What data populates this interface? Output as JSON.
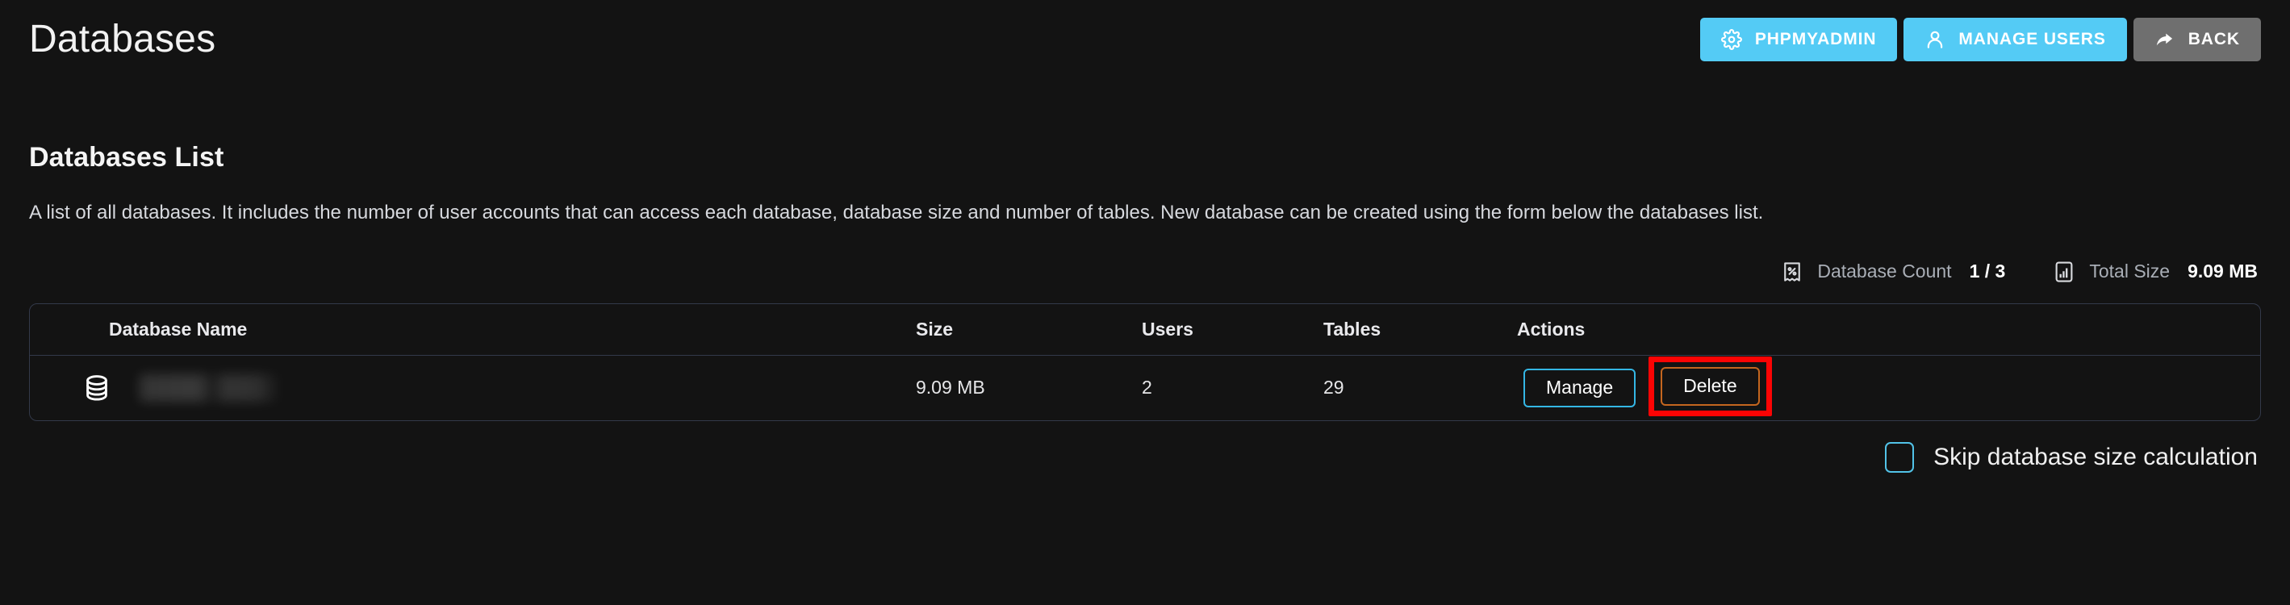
{
  "header": {
    "title": "Databases",
    "buttons": [
      {
        "label": "PHPMYADMIN",
        "icon": "gear-icon",
        "style": "primary"
      },
      {
        "label": "MANAGE USERS",
        "icon": "user-icon",
        "style": "primary"
      },
      {
        "label": "BACK",
        "icon": "arrow-share-icon",
        "style": "secondary"
      }
    ]
  },
  "main": {
    "section_title": "Databases List",
    "description": "A list of all databases. It includes the number of user accounts that can access each database, database size and number of tables. New database can be created using the form below the databases list.",
    "stats": [
      {
        "icon": "receipt-percent-icon",
        "label": "Database Count",
        "value": "1 / 3"
      },
      {
        "icon": "bar-chart-icon",
        "label": "Total Size",
        "value": "9.09 MB"
      }
    ],
    "table": {
      "columns": [
        "Database Name",
        "Size",
        "Users",
        "Tables",
        "Actions"
      ],
      "rows": [
        {
          "icon": "database-icon",
          "name": "",
          "name_redacted": true,
          "size": "9.09 MB",
          "users": "2",
          "tables": "29",
          "actions": [
            {
              "label": "Manage",
              "style": "manage"
            },
            {
              "label": "Delete",
              "style": "delete",
              "highlighted": true
            }
          ]
        }
      ]
    },
    "skip_checkbox": {
      "label": "Skip database size calculation",
      "checked": false
    }
  },
  "colors": {
    "background": "#131313",
    "accent_cyan": "#54cbf5",
    "back_gray": "#6f6f6f",
    "manage_border": "#34b6e4",
    "delete_border": "#c4661f",
    "highlight_red": "#fb0404",
    "table_border": "#33394a"
  }
}
